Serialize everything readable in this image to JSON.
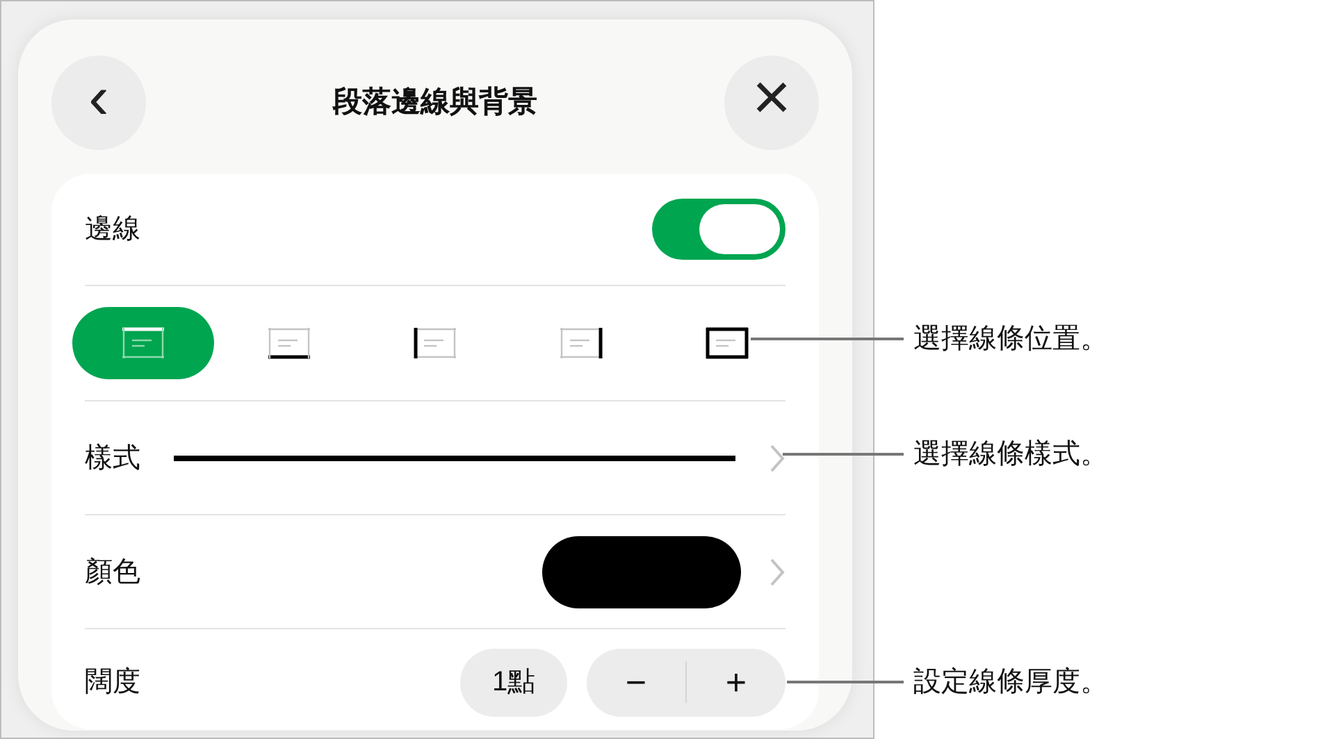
{
  "header": {
    "title": "段落邊線與背景",
    "back": "‹",
    "close": "×"
  },
  "border_toggle": {
    "label": "邊線",
    "on": true
  },
  "positions": [
    {
      "kind": "top",
      "selected": true
    },
    {
      "kind": "bottom",
      "selected": false
    },
    {
      "kind": "left",
      "selected": false
    },
    {
      "kind": "right",
      "selected": false
    },
    {
      "kind": "all",
      "selected": false
    }
  ],
  "style_row": {
    "label": "樣式"
  },
  "color_row": {
    "label": "顏色",
    "color": "#000000"
  },
  "width_row": {
    "label": "闊度",
    "value": "1點",
    "minus": "−",
    "plus": "+"
  },
  "callouts": [
    {
      "kind": "positions",
      "text": "選擇線條位置。"
    },
    {
      "kind": "style",
      "text": "選擇線條樣式。"
    },
    {
      "kind": "width",
      "text": "設定線條厚度。"
    }
  ]
}
